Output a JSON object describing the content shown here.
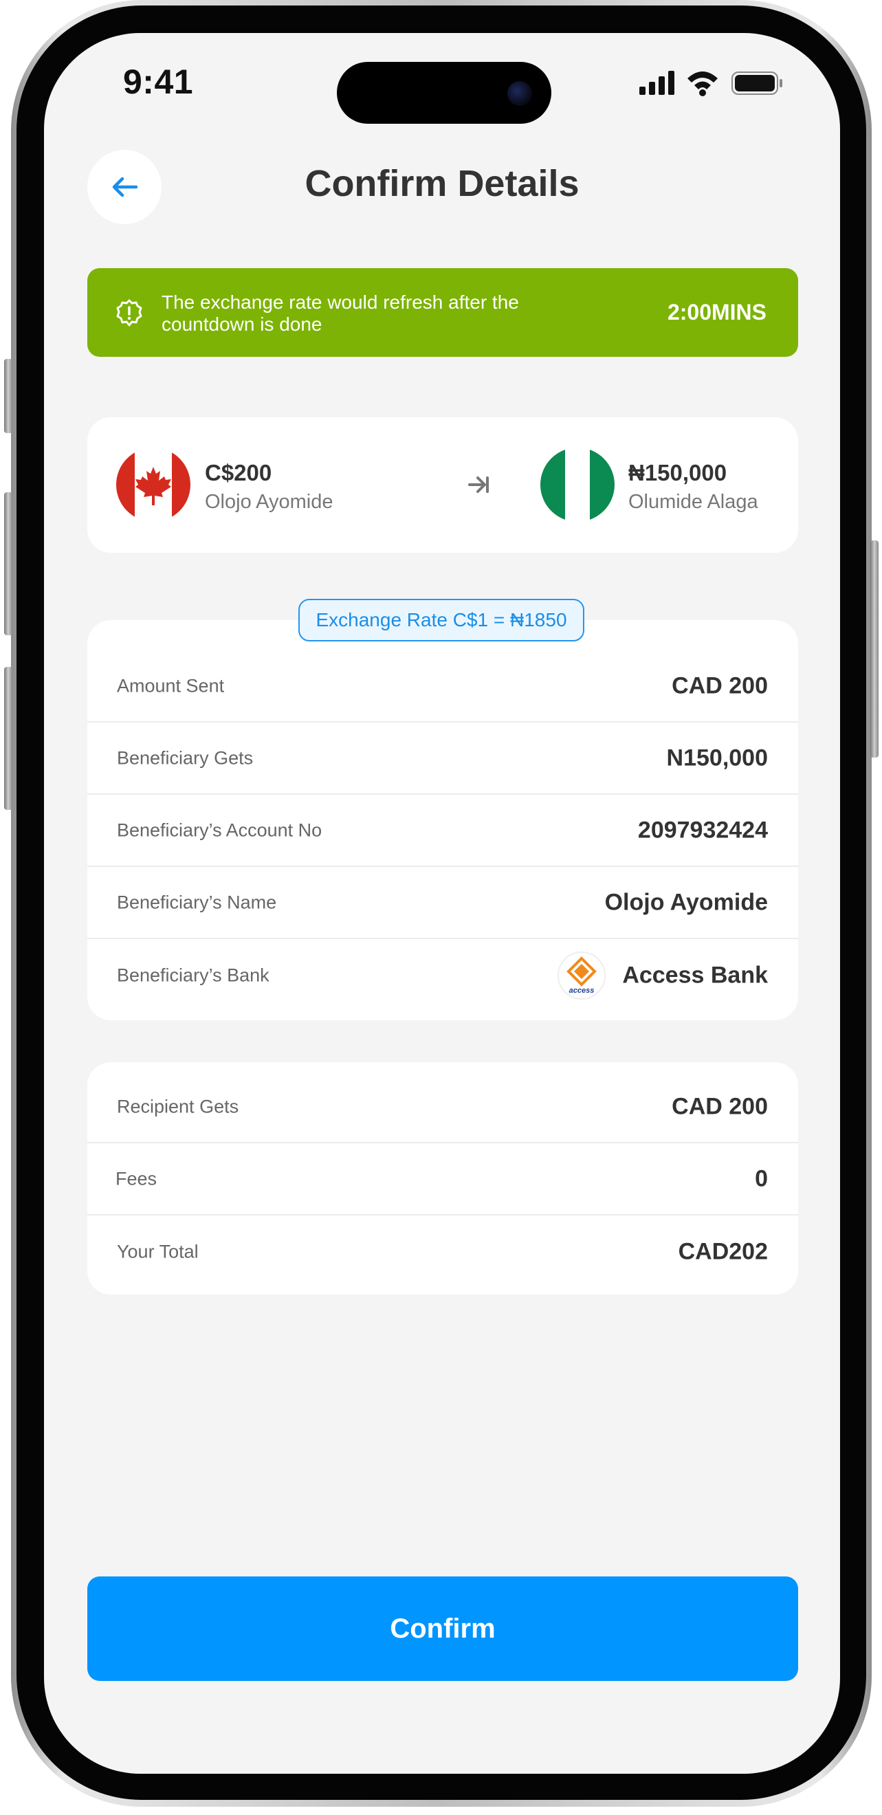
{
  "status_bar": {
    "time": "9:41",
    "icons": [
      "cellular-signal-icon",
      "wifi-icon",
      "battery-icon"
    ]
  },
  "header": {
    "back_icon": "arrow-left-icon",
    "title": "Confirm Details"
  },
  "banner": {
    "icon": "alert-badge-icon",
    "message": "The exchange rate would refresh after the countdown is done",
    "timer": "2:00MINS",
    "color": "#7cb305"
  },
  "transfer": {
    "from": {
      "amount": "C$200",
      "name": "Olojo Ayomide",
      "flag": "canada-flag"
    },
    "to": {
      "amount": "₦150,000",
      "name": "Olumide Alaga",
      "flag": "nigeria-flag"
    }
  },
  "exchange_rate": "Exchange Rate C$1 = ₦1850",
  "details": [
    {
      "label": "Amount Sent",
      "value": "CAD 200"
    },
    {
      "label": "Beneficiary Gets",
      "value": "N150,000"
    },
    {
      "label": "Beneficiary’s Account No",
      "value": "2097932424"
    },
    {
      "label": "Beneficiary’s Name",
      "value": "Olojo Ayomide"
    },
    {
      "label": "Beneficiary’s Bank",
      "value": "Access Bank",
      "logo_text": "access"
    }
  ],
  "summary": [
    {
      "label": "Recipient Gets",
      "value": "CAD 200"
    },
    {
      "label": "Fees",
      "value": "0"
    },
    {
      "label": "Your Total",
      "value": "CAD202"
    }
  ],
  "confirm_label": "Confirm",
  "colors": {
    "accent": "#0095ff",
    "warning_banner": "#7cb305",
    "background": "#f4f4f4"
  }
}
